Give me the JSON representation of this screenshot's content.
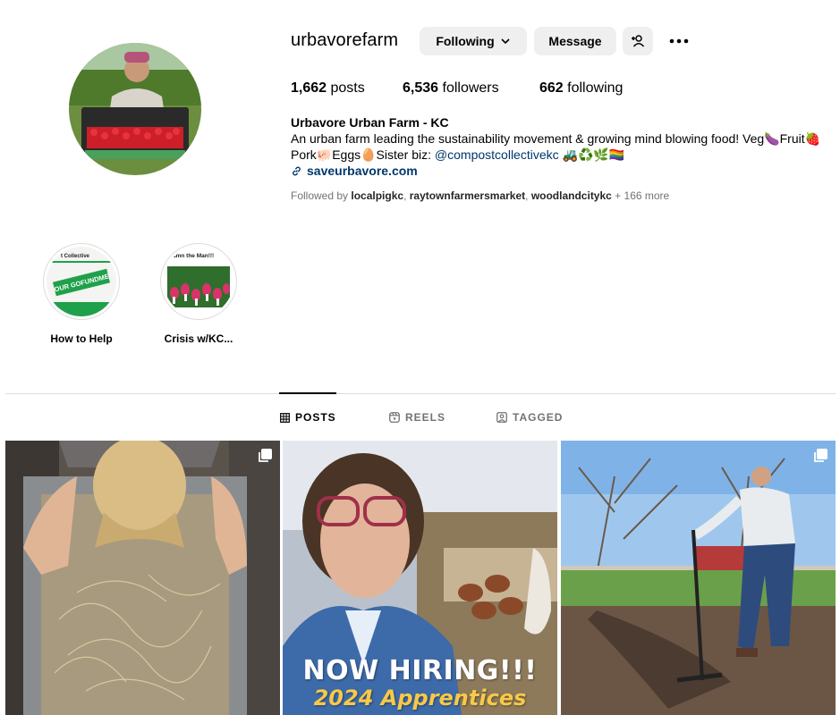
{
  "profile": {
    "username": "urbavorefarm",
    "following_label": "Following",
    "message_label": "Message",
    "posts_count": "1,662",
    "posts_label": "posts",
    "followers_count": "6,536",
    "followers_label": "followers",
    "following_count": "662",
    "following_count_label": "following",
    "name": "Urbavore Urban Farm - KC",
    "bio_line1": "An urban farm leading the sustainability movement & growing mind blowing food! Veg🍆Fruit🍓",
    "bio_line2_prefix": "Pork🐖Eggs🥚Sister biz: ",
    "bio_mention": "@compostcollectivekc",
    "bio_line2_suffix": " 🚜♻️🌿🏳️‍🌈",
    "link": "saveurbavore.com",
    "followed_by_prefix": "Followed by ",
    "followed_by_accounts": [
      "localpigkc",
      "raytownfarmersmarket",
      "woodlandcitykc"
    ],
    "followed_by_more": " + 166 more"
  },
  "highlights": [
    {
      "label": "How to Help",
      "art_text_top": "t Collective",
      "art_text_badge": "OUR GOFUNDME"
    },
    {
      "label": "Crisis w/KC...",
      "art_text_top": "amn the Man!!!"
    }
  ],
  "tabs": [
    {
      "label": "POSTS",
      "active": true
    },
    {
      "label": "REELS",
      "active": false
    },
    {
      "label": "TAGGED",
      "active": false
    }
  ],
  "posts": [
    {
      "icon": "carousel-icon"
    },
    {
      "icon": "carousel-icon",
      "line1": "NOW HIRING!!!",
      "line2": "2024 Apprentices"
    },
    {
      "icon": "carousel-icon"
    }
  ],
  "colors": {
    "button_bg": "#efefef",
    "link": "#00376b",
    "muted": "#737373",
    "hiring_yellow": "#f7c948"
  }
}
